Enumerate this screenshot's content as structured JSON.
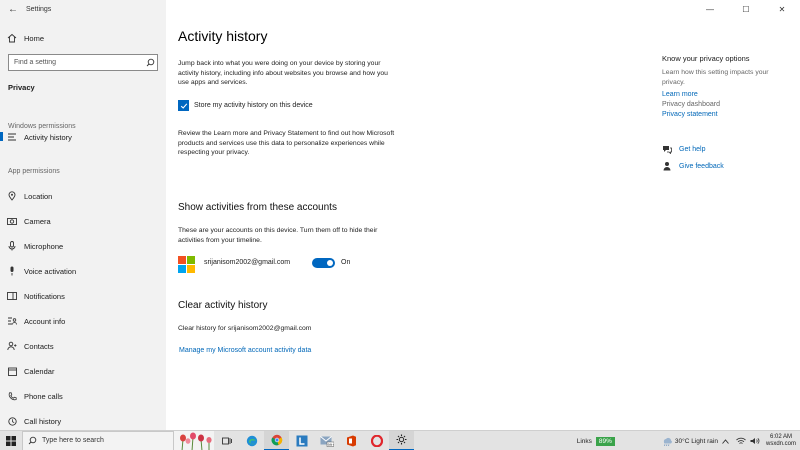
{
  "window": {
    "title": "Settings",
    "minimize": "—",
    "maximize": "☐",
    "close": "✕"
  },
  "sidebar": {
    "home": "Home",
    "search_placeholder": "Find a setting",
    "section_title": "Privacy",
    "windows_permissions_header": "Windows permissions",
    "activity_item": "Activity history",
    "app_permissions_header": "App permissions",
    "items": [
      {
        "label": "Location",
        "icon": "location-icon"
      },
      {
        "label": "Camera",
        "icon": "camera-icon"
      },
      {
        "label": "Microphone",
        "icon": "microphone-icon"
      },
      {
        "label": "Voice activation",
        "icon": "voice-activation-icon"
      },
      {
        "label": "Notifications",
        "icon": "notifications-icon"
      },
      {
        "label": "Account info",
        "icon": "account-info-icon"
      },
      {
        "label": "Contacts",
        "icon": "contacts-icon"
      },
      {
        "label": "Calendar",
        "icon": "calendar-icon"
      },
      {
        "label": "Phone calls",
        "icon": "phone-calls-icon"
      },
      {
        "label": "Call history",
        "icon": "call-history-icon"
      }
    ]
  },
  "main": {
    "title": "Activity history",
    "intro_line1": "Jump back into what you were doing on your device by storing your",
    "intro_line2": "activity history, including info about websites you browse and how you",
    "intro_line3": "use apps and services.",
    "store_checkbox_label": "Store my activity history on this device",
    "review_line1": "Review the Learn more and Privacy Statement to find out how Microsoft",
    "review_line2": "products and services use this data to personalize experiences while",
    "review_line3": "respecting your privacy.",
    "accounts_title": "Show activities from these accounts",
    "accounts_desc_line1": "These are your accounts on this device. Turn them off to hide their",
    "accounts_desc_line2": "activities from your timeline.",
    "account_email": "srijanisom2002@gmail.com",
    "toggle_state": "On",
    "clear_title": "Clear activity history",
    "clear_desc": "Clear history for srijanisom2002@gmail.com",
    "manage_link": "Manage my Microsoft account activity data"
  },
  "right_panel": {
    "title": "Know your privacy options",
    "desc_line1": "Learn how this setting impacts your",
    "desc_line2": "privacy.",
    "learn_more": "Learn more",
    "privacy_dashboard": "Privacy dashboard",
    "privacy_statement": "Privacy statement",
    "get_help": "Get help",
    "give_feedback": "Give feedback"
  },
  "taskbar": {
    "search_text": "Type here to search",
    "links_label": "Links",
    "battery": "89%",
    "weather": "30°C  Light rain",
    "time": "6:02 AM",
    "date": "wsxdn.com"
  },
  "colors": {
    "accent": "#0067c0",
    "link": "#0067b8",
    "sidebar_bg": "#f2f2f2"
  }
}
